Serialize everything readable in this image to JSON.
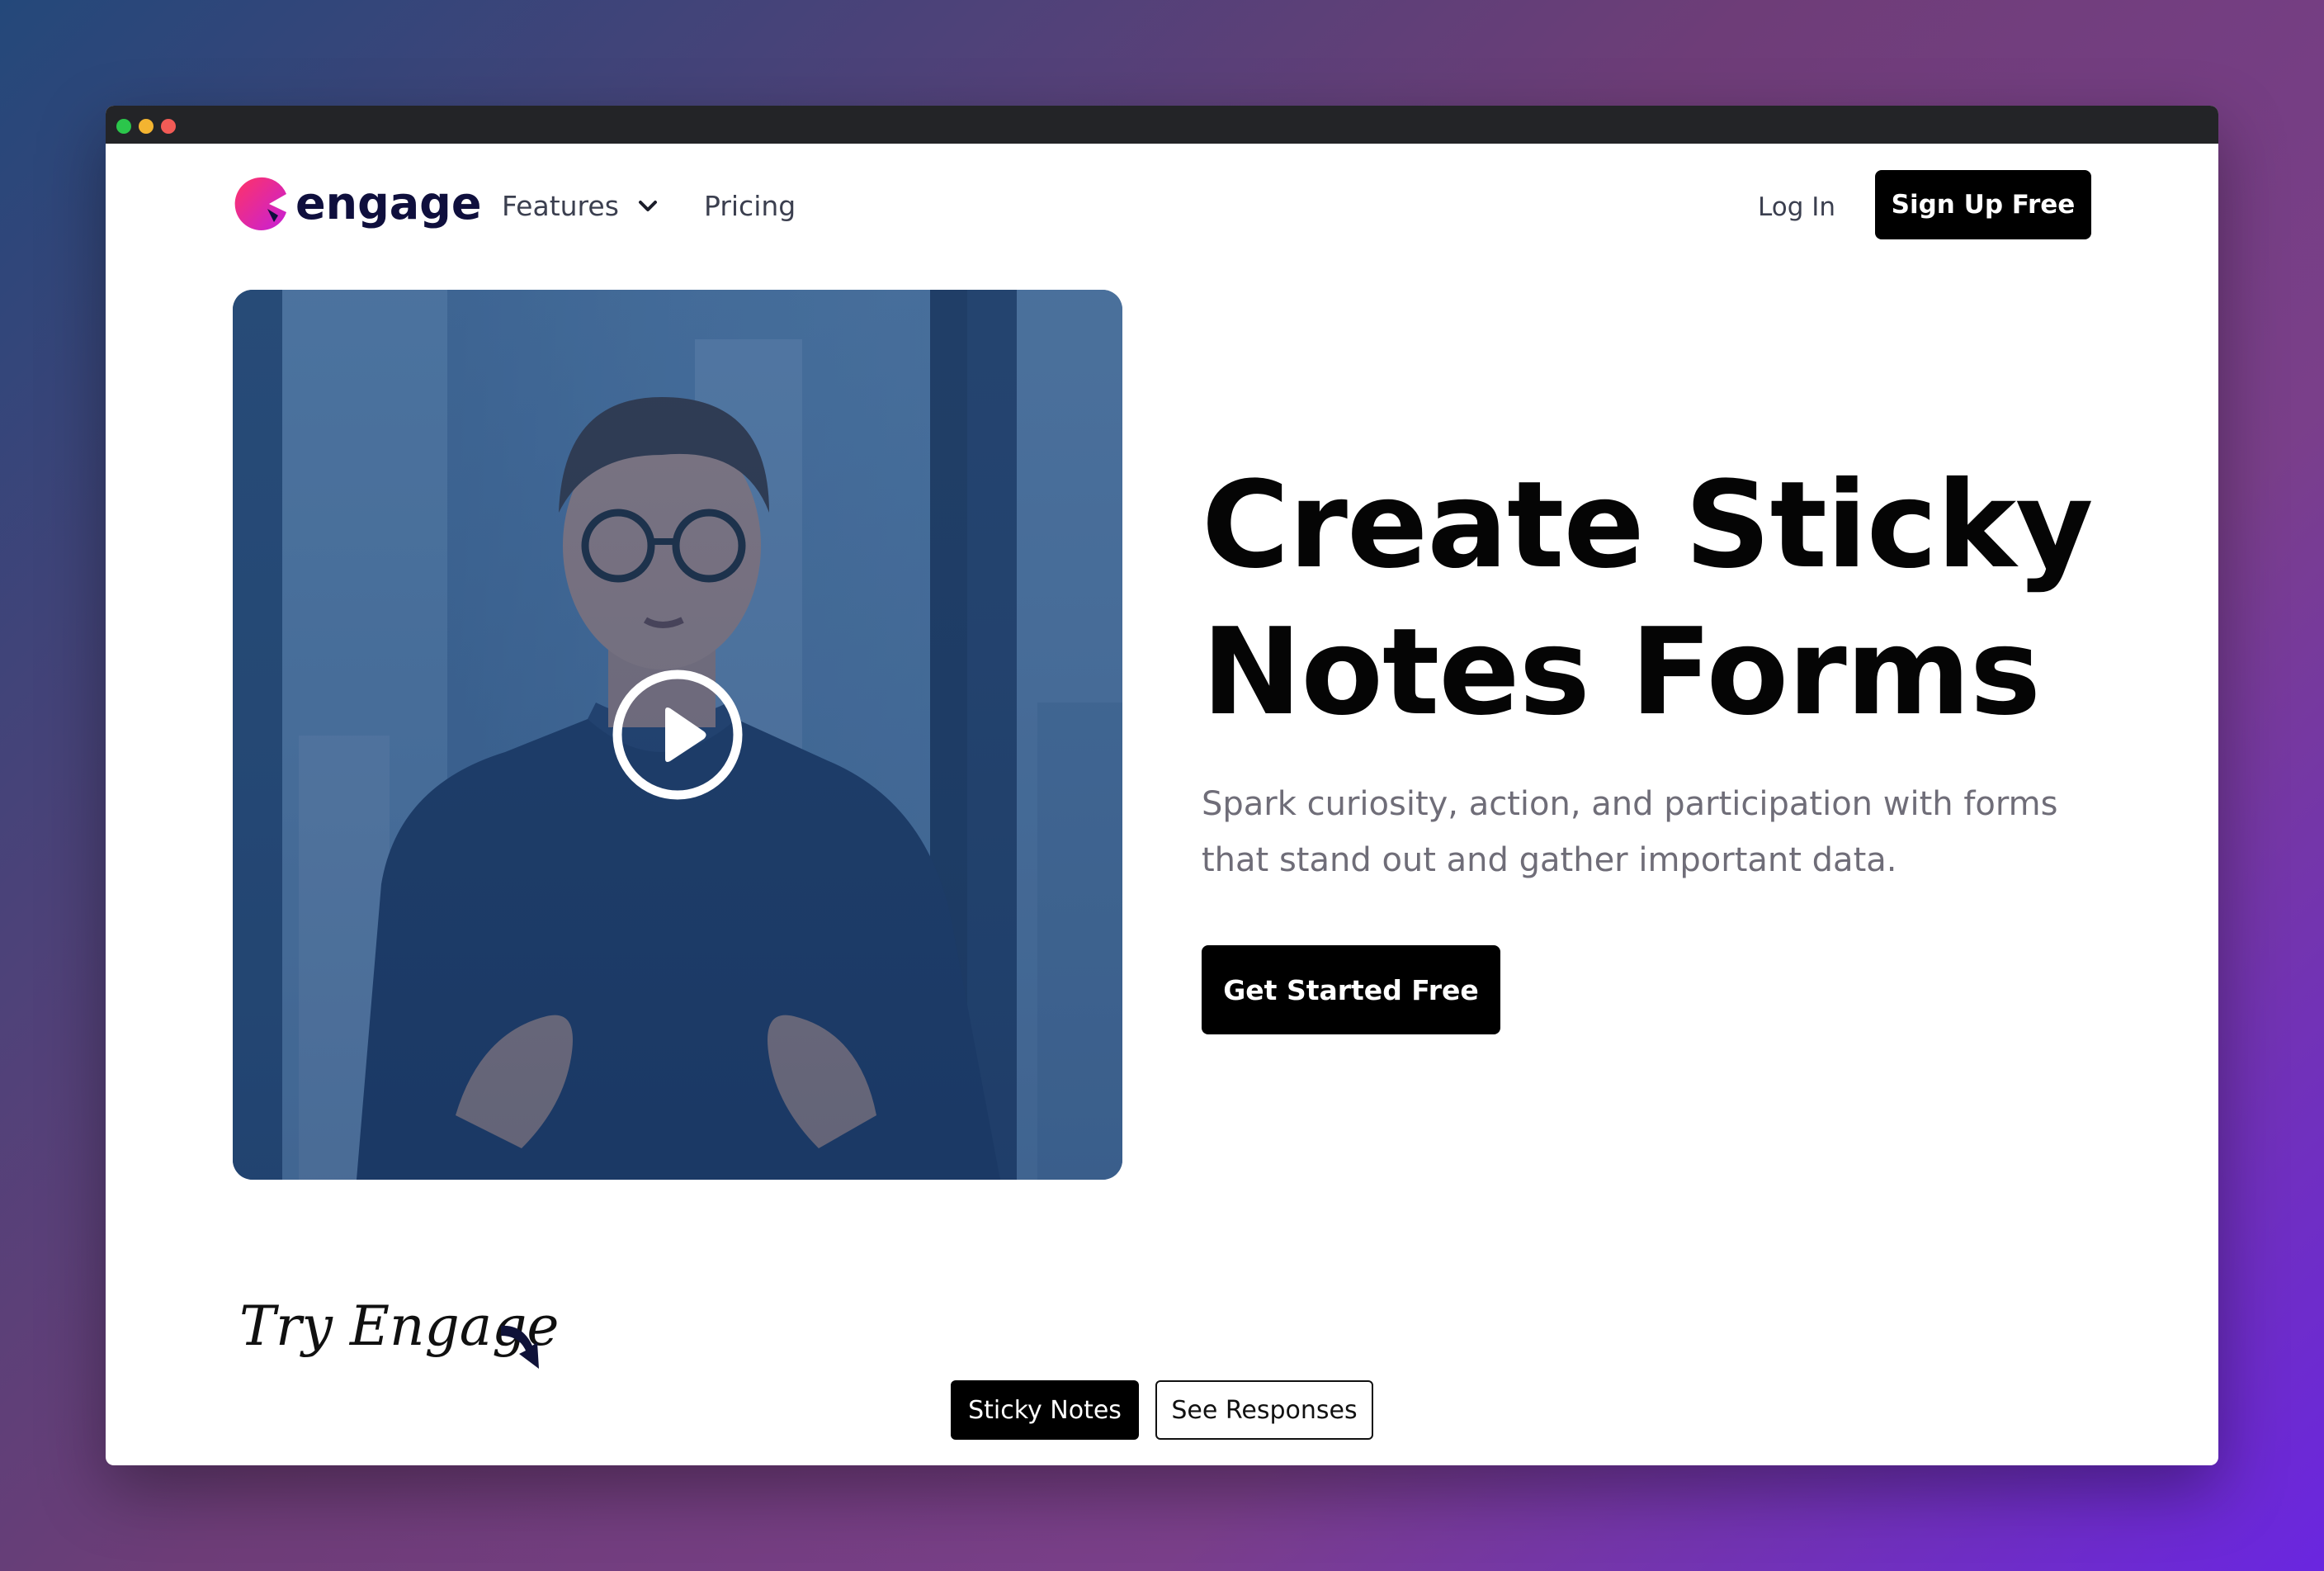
{
  "window": {
    "controls": [
      "close",
      "minimize",
      "maximize"
    ]
  },
  "header": {
    "brand": "engage",
    "logo_icon": "engage-logo-icon",
    "nav": {
      "features_label": "Features",
      "features_icon": "chevron-down-icon",
      "pricing_label": "Pricing"
    },
    "login_label": "Log In",
    "signup_label": "Sign Up Free"
  },
  "hero": {
    "video_icon": "play-icon",
    "headline_line1": "Create Sticky",
    "headline_line2": "Notes Forms",
    "subtext": "Spark curiosity, action, and participation with forms that stand out and gather important data.",
    "cta_label": "Get Started Free"
  },
  "try_section": {
    "title": "Try Engage",
    "arrow_icon": "curved-arrow-down-icon",
    "tabs": [
      {
        "label": "Sticky Notes",
        "selected": true
      },
      {
        "label": "See Responses",
        "selected": false
      }
    ]
  },
  "colors": {
    "brand_gradient_start": "#ff3d8a",
    "brand_gradient_end": "#c41fd9",
    "button_bg": "#000000",
    "text_dark": "#0f0f3d",
    "video_overlay": "#1f4a80"
  }
}
